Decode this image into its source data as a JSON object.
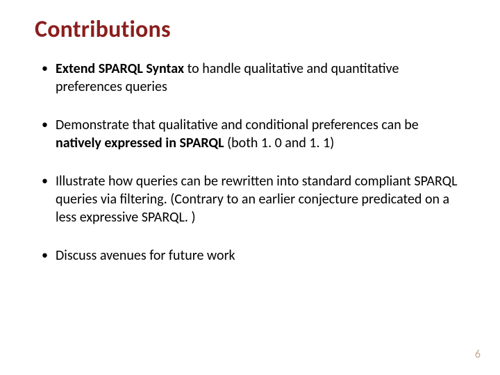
{
  "title": "Contributions",
  "bullets": [
    {
      "segments": [
        {
          "text": "Extend SPARQL Syntax",
          "bold": true
        },
        {
          "text": " to handle qualitative and quantitative preferences queries",
          "bold": false
        }
      ]
    },
    {
      "segments": [
        {
          "text": "Demonstrate that qualitative and conditional preferences can be ",
          "bold": false
        },
        {
          "text": "natively expressed in SPARQL",
          "bold": true
        },
        {
          "text": " (both 1. 0 and 1. 1)",
          "bold": false
        }
      ]
    },
    {
      "segments": [
        {
          "text": "Illustrate how  queries can be rewritten into standard compliant SPARQL queries via filtering.  (Contrary to an earlier conjecture predicated on a less expressive SPARQL. )",
          "bold": false
        }
      ]
    },
    {
      "segments": [
        {
          "text": "Discuss avenues for future work",
          "bold": false
        }
      ]
    }
  ],
  "page_number": "6"
}
